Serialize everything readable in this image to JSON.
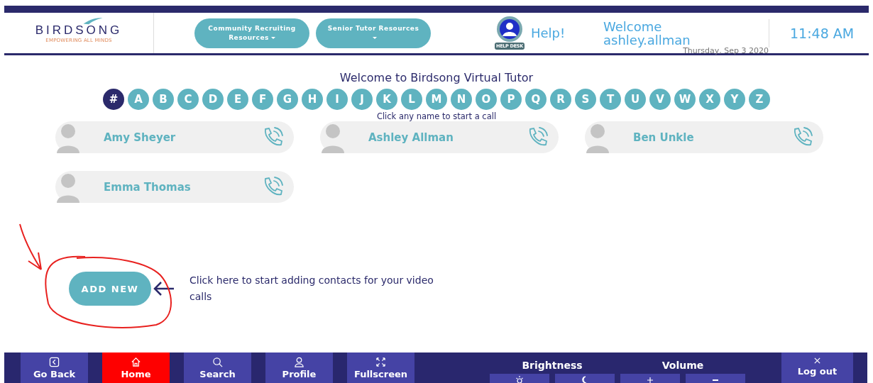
{
  "header": {
    "logo": {
      "name": "BIRDSONG",
      "tagline": "EMPOWERING ALL MINDS"
    },
    "menus": [
      {
        "label": "Community Recruiting Resources"
      },
      {
        "label": "Senior Tutor Resources"
      }
    ],
    "help": {
      "badge": "HELP DESK",
      "label": "Help!"
    },
    "welcome": {
      "greeting": "Welcome",
      "user": "ashley.allman",
      "date": "Thursday, Sep 3 2020"
    },
    "time": "11:48 AM"
  },
  "title": "Welcome to Birdsong Virtual Tutor",
  "letters": [
    {
      "label": "#",
      "selected": true
    },
    {
      "label": "A",
      "selected": false
    },
    {
      "label": "B",
      "selected": false
    },
    {
      "label": "C",
      "selected": false
    },
    {
      "label": "D",
      "selected": false
    },
    {
      "label": "E",
      "selected": false
    },
    {
      "label": "F",
      "selected": false
    },
    {
      "label": "G",
      "selected": false
    },
    {
      "label": "H",
      "selected": false
    },
    {
      "label": "I",
      "selected": false
    },
    {
      "label": "J",
      "selected": false
    },
    {
      "label": "K",
      "selected": false
    },
    {
      "label": "L",
      "selected": false
    },
    {
      "label": "M",
      "selected": false
    },
    {
      "label": "N",
      "selected": false
    },
    {
      "label": "O",
      "selected": false
    },
    {
      "label": "P",
      "selected": false
    },
    {
      "label": "Q",
      "selected": false
    },
    {
      "label": "R",
      "selected": false
    },
    {
      "label": "S",
      "selected": false
    },
    {
      "label": "T",
      "selected": false
    },
    {
      "label": "U",
      "selected": false
    },
    {
      "label": "V",
      "selected": false
    },
    {
      "label": "W",
      "selected": false
    },
    {
      "label": "X",
      "selected": false
    },
    {
      "label": "Y",
      "selected": false
    },
    {
      "label": "Z",
      "selected": false
    }
  ],
  "hint": "Click any name to start a call",
  "contacts": [
    {
      "name": "Amy Sheyer"
    },
    {
      "name": "Ashley Allman"
    },
    {
      "name": "Ben Unkle"
    },
    {
      "name": "Emma Thomas"
    }
  ],
  "add_new": {
    "label": "ADD NEW",
    "note": "Click here to start adding contacts for your video calls"
  },
  "bottom_bar": {
    "nav": [
      {
        "label": "Go Back",
        "kind": "back",
        "selected": false
      },
      {
        "label": "Home",
        "kind": "home",
        "selected": true
      },
      {
        "label": "Search",
        "kind": "search",
        "selected": false
      },
      {
        "label": "Profile",
        "kind": "profile",
        "selected": false
      },
      {
        "label": "Fullscreen",
        "kind": "fullscreen",
        "selected": false
      }
    ],
    "groups": [
      {
        "label": "Brightness",
        "buttons": [
          {
            "kind": "sun"
          },
          {
            "kind": "moon"
          }
        ]
      },
      {
        "label": "Volume",
        "buttons": [
          {
            "kind": "plus"
          },
          {
            "kind": "minus"
          }
        ]
      }
    ],
    "logout": {
      "label": "Log out"
    }
  }
}
